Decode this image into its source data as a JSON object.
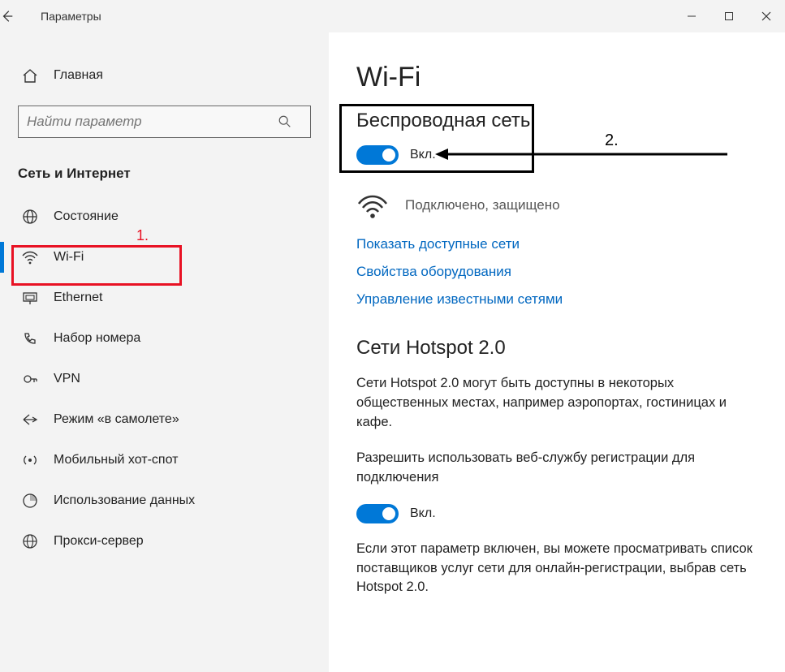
{
  "titlebar": {
    "title": "Параметры"
  },
  "sidebar": {
    "home_label": "Главная",
    "search_placeholder": "Найти параметр",
    "category": "Сеть и Интернет",
    "items": [
      {
        "label": "Состояние",
        "icon": "globe-status-icon"
      },
      {
        "label": "Wi-Fi",
        "icon": "wifi-icon",
        "active": true
      },
      {
        "label": "Ethernet",
        "icon": "ethernet-icon"
      },
      {
        "label": "Набор номера",
        "icon": "dialup-icon"
      },
      {
        "label": "VPN",
        "icon": "vpn-icon"
      },
      {
        "label": "Режим «в самолете»",
        "icon": "airplane-icon"
      },
      {
        "label": "Мобильный хот-спот",
        "icon": "hotspot-icon"
      },
      {
        "label": "Использование данных",
        "icon": "data-usage-icon"
      },
      {
        "label": "Прокси-сервер",
        "icon": "proxy-icon"
      }
    ]
  },
  "content": {
    "page_title": "Wi-Fi",
    "wireless": {
      "heading": "Беспроводная сеть",
      "toggle_label": "Вкл."
    },
    "connection": {
      "status": "Подключено, защищено"
    },
    "links": {
      "show_networks": "Показать доступные сети",
      "hw_props": "Свойства оборудования",
      "manage_known": "Управление известными сетями"
    },
    "hotspot2": {
      "heading": "Сети Hotspot 2.0",
      "desc1": "Сети Hotspot 2.0 могут быть доступны в некоторых общественных местах, например аэропортах, гостиницах и кафе.",
      "allow_label": "Разрешить использовать веб-службу регистрации для подключения",
      "toggle_label": "Вкл.",
      "desc2": "Если этот параметр включен, вы можете просматривать список поставщиков услуг сети для онлайн-регистрации, выбрав сеть Hotspot 2.0."
    }
  },
  "annotations": {
    "label1": "1.",
    "label2": "2."
  }
}
